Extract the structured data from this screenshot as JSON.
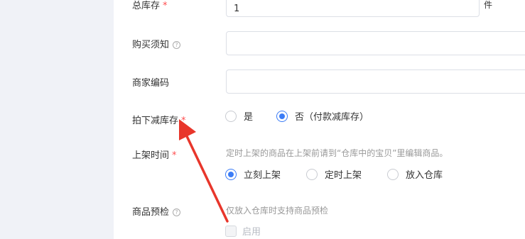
{
  "form": {
    "total_stock": {
      "label": "总库存",
      "required_mark": "*",
      "value": "1",
      "unit": "件"
    },
    "purchase_notice": {
      "label": "购买须知",
      "help_icon": "?",
      "value": ""
    },
    "merchant_code": {
      "label": "商家编码",
      "value": ""
    },
    "stock_deduction": {
      "label": "拍下减库存",
      "required_mark": "*",
      "options": [
        {
          "label": "是",
          "selected": false
        },
        {
          "label": "否（付款减库存）",
          "selected": true
        }
      ]
    },
    "listing_time": {
      "label": "上架时间",
      "required_mark": "*",
      "hint": "定时上架的商品在上架前请到“仓库中的宝贝”里编辑商品。",
      "options": [
        {
          "label": "立刻上架",
          "selected": true
        },
        {
          "label": "定时上架",
          "selected": false
        },
        {
          "label": "放入仓库",
          "selected": false
        }
      ]
    },
    "product_precheck": {
      "label": "商品预检",
      "help_icon": "?",
      "hint": "仅放入仓库时支持商品预检",
      "checkbox_label": "启用",
      "checkbox_checked": false,
      "checkbox_disabled": true
    }
  },
  "annotation": {
    "color": "#e8362b"
  },
  "colors": {
    "accent": "#3b7cf6",
    "required": "#ff4d4f",
    "page_bg": "#f0f2f7"
  }
}
